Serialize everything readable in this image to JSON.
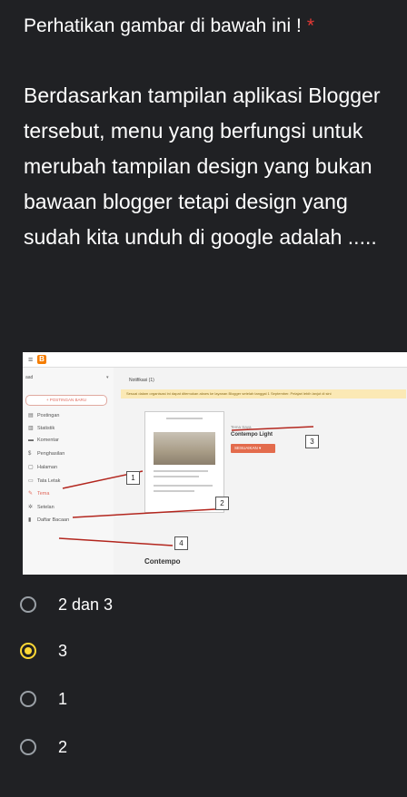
{
  "question": {
    "title": "Perhatikan gambar di bawah ini !",
    "required_mark": "*",
    "body": "Berdasarkan tampilan aplikasi Blogger tersebut, menu yang berfungsi untuk merubah tampilan design yang bukan bawaan blogger tetapi design yang sudah kita unduh di google adalah ....."
  },
  "screenshot": {
    "blog_name": "aad",
    "new_post": "+ POSTINGAN BARU",
    "notification": "Notifikasi (1)",
    "banner": "Sesuai dalam organisasi ini dapat ditemukan akses ke layanan Blogger setelah tanggal 1 September. Pelajari lebih lanjut di sini",
    "menu": [
      {
        "icon": "▤",
        "label": "Postingan"
      },
      {
        "icon": "▥",
        "label": "Statistik"
      },
      {
        "icon": "▬",
        "label": "Komentar"
      },
      {
        "icon": "$",
        "label": "Penghasilan"
      },
      {
        "icon": "▢",
        "label": "Halaman"
      },
      {
        "icon": "▭",
        "label": "Tata Letak"
      },
      {
        "icon": "✎",
        "label": "Tema"
      },
      {
        "icon": "✲",
        "label": "Setelan"
      },
      {
        "icon": "▮",
        "label": "Daftar Bacaan"
      }
    ],
    "theme_label": "Tema Saya",
    "theme_name": "Contempo Light",
    "customize": "SESUAIKAN ▾",
    "contempo": "Contempo",
    "numbers": [
      "1",
      "2",
      "3",
      "4"
    ]
  },
  "options": [
    {
      "label": "2 dan 3",
      "selected": false
    },
    {
      "label": "3",
      "selected": true
    },
    {
      "label": "1",
      "selected": false
    },
    {
      "label": "2",
      "selected": false
    }
  ],
  "colors": {
    "accent": "#fdd835",
    "required": "#e53935",
    "arrow": "#b3261e"
  }
}
